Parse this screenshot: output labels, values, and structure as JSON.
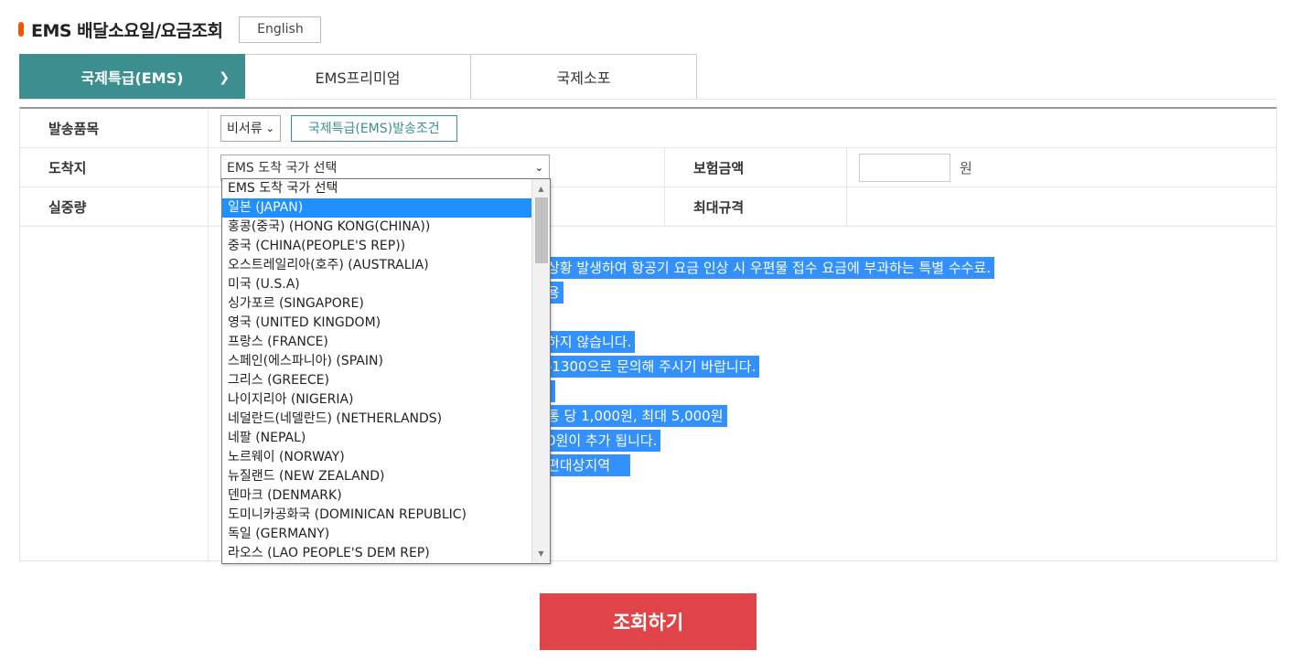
{
  "header": {
    "title": "EMS 배달소요일/요금조회",
    "lang_button": "English"
  },
  "tabs": [
    {
      "label": "국제특급(EMS)",
      "active": true
    },
    {
      "label": "EMS프리미엄",
      "active": false
    },
    {
      "label": "국제소포",
      "active": false
    }
  ],
  "form": {
    "item_label": "발송품목",
    "item_value": "비서류",
    "cond_button": "국제특급(EMS)발송조건",
    "dest_label": "도착지",
    "dest_value": "EMS 도착 국가 선택",
    "insurance_label": "보험금액",
    "insurance_value": "",
    "won_unit": "원",
    "weight_label": "실중량",
    "max_size_label": "최대규격"
  },
  "notes": [
    "상황 발생하여 항공기 요금 인상 시 우편물 접수 요금에 부과하는 특별 수수료.",
    "용",
    "",
    "하지 않습니다.",
    "-1300으로 문의해 주시기 바랍니다.",
    ".",
    "통 당 1,000원, 최대 5,000원",
    "0원이 추가 됩니다.",
    "편대상지역"
  ],
  "dropdown": {
    "options": [
      "EMS 도착 국가 선택",
      "일본 (JAPAN)",
      "홍콩(중국) (HONG KONG(CHINA))",
      "중국 (CHINA(PEOPLE'S REP))",
      "오스트레일리아(호주) (AUSTRALIA)",
      "미국 (U.S.A)",
      "싱가포르 (SINGAPORE)",
      "영국 (UNITED KINGDOM)",
      "프랑스 (FRANCE)",
      "스페인(에스파니아) (SPAIN)",
      "그리스 (GREECE)",
      "나이지리아 (NIGERIA)",
      "네덜란드(네델란드) (NETHERLANDS)",
      "네팔 (NEPAL)",
      "노르웨이 (NORWAY)",
      "뉴질랜드 (NEW ZEALAND)",
      "덴마크 (DENMARK)",
      "도미니카공화국 (DOMINICAN REPUBLIC)",
      "독일 (GERMANY)",
      "라오스 (LAO PEOPLE'S DEM REP)"
    ],
    "highlighted_index": 1
  },
  "search_button": "조회하기",
  "colors": {
    "accent": "#3d8f8f",
    "search": "#e04448",
    "highlight": "#1e90ff"
  }
}
